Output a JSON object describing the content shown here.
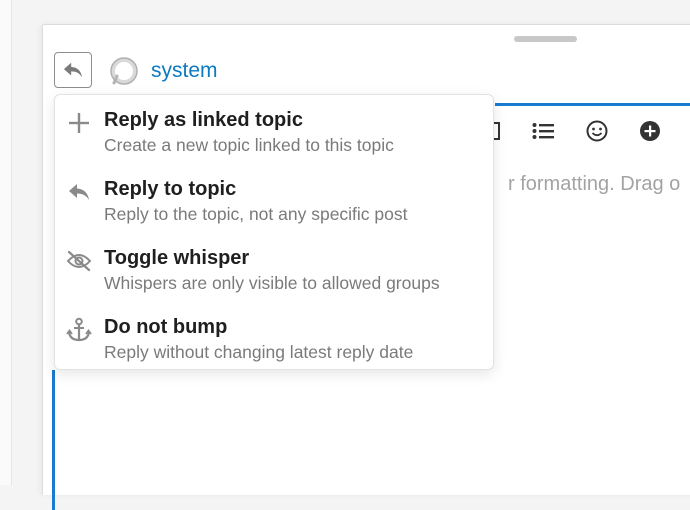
{
  "composer": {
    "user_name": "system",
    "editor_placeholder": "r formatting. Drag o"
  },
  "toolbar": {
    "icons": [
      "code-icon",
      "bullet-list-icon",
      "emoji-icon",
      "plus-circle-icon"
    ]
  },
  "reply_menu": {
    "items": [
      {
        "icon": "plus-icon",
        "title": "Reply as linked topic",
        "description": "Create a new topic linked to this topic"
      },
      {
        "icon": "reply-icon",
        "title": "Reply to topic",
        "description": "Reply to the topic, not any specific post"
      },
      {
        "icon": "eye-slash-icon",
        "title": "Toggle whisper",
        "description": "Whispers are only visible to allowed groups"
      },
      {
        "icon": "anchor-icon",
        "title": "Do not bump",
        "description": "Reply without changing latest reply date"
      }
    ]
  },
  "colors": {
    "link": "#0a7ac2",
    "editor_focus": "#1a7bd0",
    "icon_gray": "#8a8a8a"
  }
}
